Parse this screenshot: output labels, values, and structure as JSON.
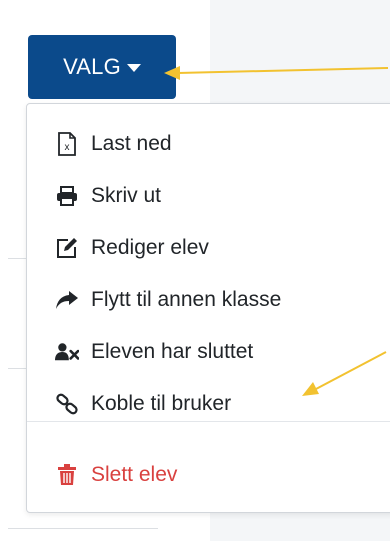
{
  "button": {
    "label": "VALG"
  },
  "menu": {
    "items": [
      {
        "label": "Last ned",
        "icon": "excel-file-icon"
      },
      {
        "label": "Skriv ut",
        "icon": "printer-icon"
      },
      {
        "label": "Rediger elev",
        "icon": "edit-icon"
      },
      {
        "label": "Flytt til annen klasse",
        "icon": "share-arrow-icon"
      },
      {
        "label": "Eleven har sluttet",
        "icon": "remove-user-icon"
      },
      {
        "label": "Koble til bruker",
        "icon": "link-icon"
      }
    ],
    "delete_item": {
      "label": "Slett elev",
      "icon": "trash-icon"
    }
  },
  "colors": {
    "button_bg": "#0b4a8b",
    "danger": "#d9413f",
    "arrow": "#f2c230"
  }
}
